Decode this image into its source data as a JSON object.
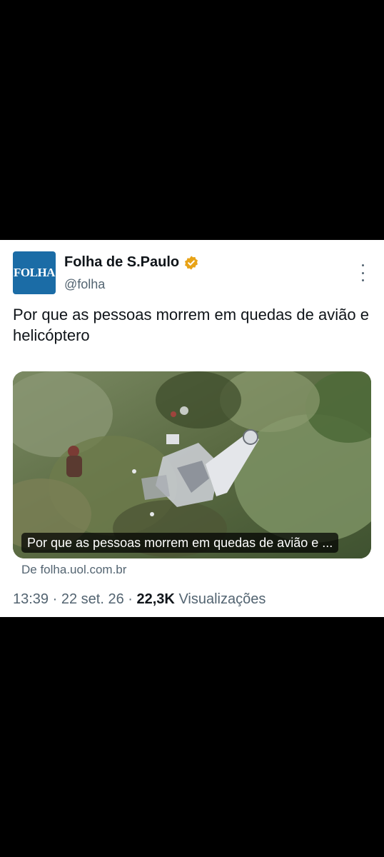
{
  "account": {
    "avatar_text": "FOLHA",
    "name": "Folha de S.Paulo",
    "handle": "@folha"
  },
  "tweet": {
    "text": "Por que as pessoas morrem em quedas de avião e helicóptero"
  },
  "card": {
    "image": "aerial view of aircraft wreckage among dense vegetation",
    "caption": "Por que as pessoas morrem em quedas de avião e ...",
    "source": "De folha.uol.com.br"
  },
  "meta": {
    "time": "13:39",
    "date": "22 set. 26",
    "views_count": "22,3K",
    "views_label": "Visualizações",
    "separator": "·"
  },
  "colors": {
    "avatar_bg": "#1b6ca6",
    "verified_badge": "#e8a317",
    "text_primary": "#0f1419",
    "text_secondary": "#536471"
  }
}
